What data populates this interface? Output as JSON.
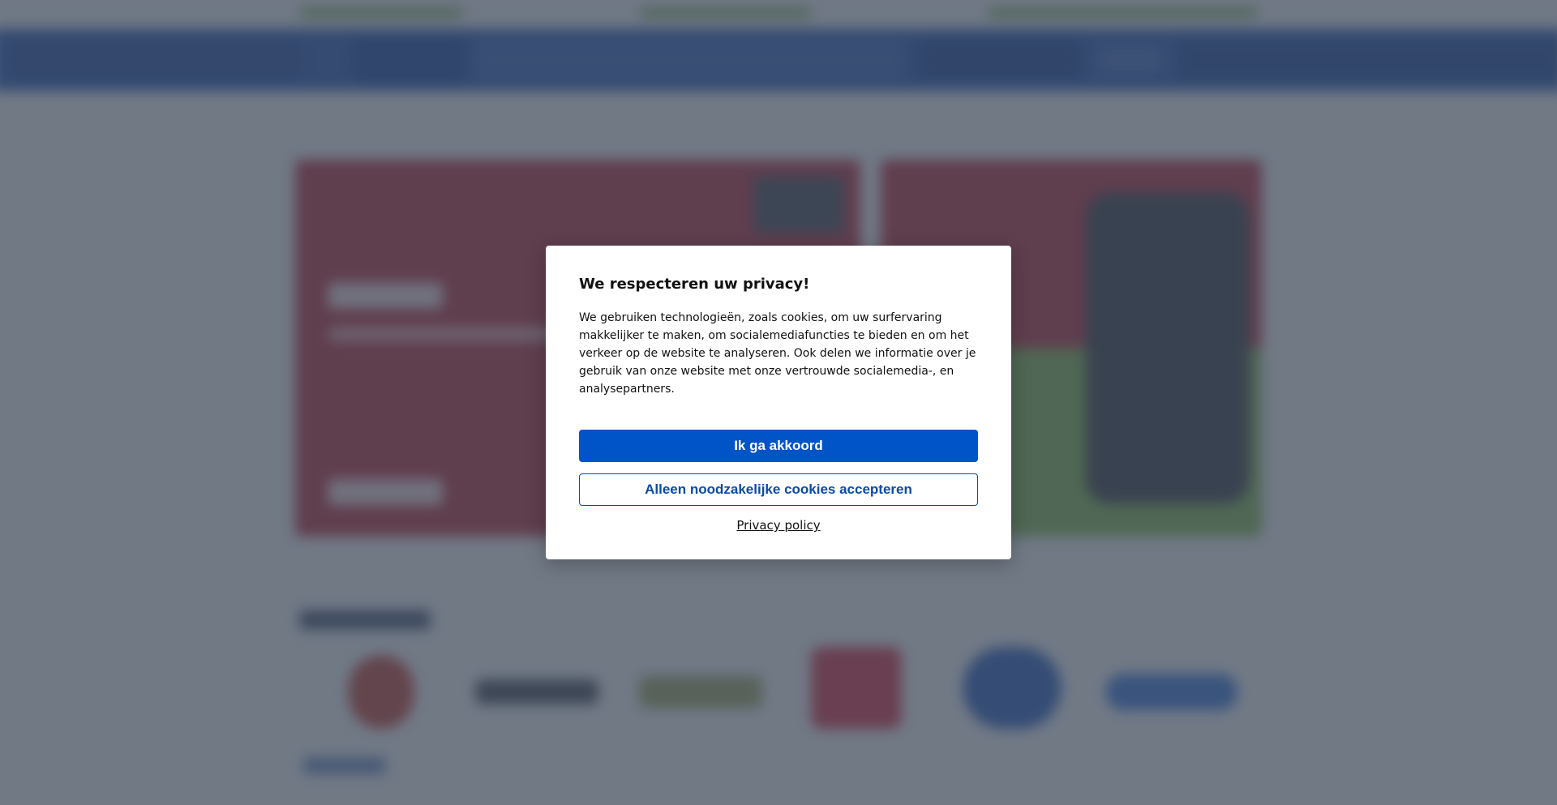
{
  "cookie_modal": {
    "title": "We respecteren uw privacy!",
    "body": "We gebruiken technologieën, zoals cookies, om uw surfervaring makkelijker te maken, om socialemediafuncties te bieden en om het verkeer op de website te analyseren. Ook delen we informatie over je gebruik van onze website met onze vertrouwde socialemedia-, en analysepartners.",
    "accept_label": "Ik ga akkoord",
    "necessary_only_label": "Alleen noodzakelijke cookies accepteren",
    "privacy_link_label": "Privacy policy"
  },
  "colors": {
    "header_blue": "#1d4fae",
    "primary_button": "#0054c8",
    "secondary_border": "#0a4aa8",
    "hero_red": "#b52230",
    "hero_green": "#7bb445"
  }
}
